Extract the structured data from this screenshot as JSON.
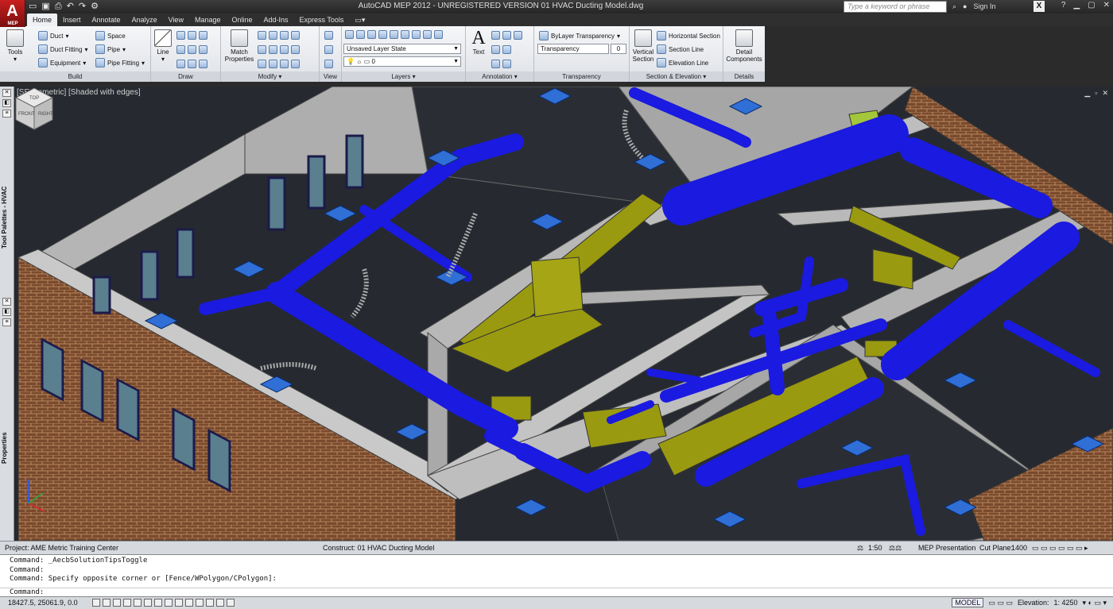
{
  "app": {
    "logo_letter": "A",
    "logo_sub": "MEP",
    "title": "AutoCAD MEP 2012 - UNREGISTERED VERSION    01 HVAC Ducting Model.dwg"
  },
  "quick_access": [
    "open-icon",
    "save-icon",
    "print-icon",
    "undo-icon",
    "redo-icon"
  ],
  "search": {
    "placeholder": "Type a keyword or phrase"
  },
  "signin": {
    "label": "Sign In"
  },
  "help": {
    "label": "?"
  },
  "tabs": [
    {
      "label": "Home"
    },
    {
      "label": "Insert"
    },
    {
      "label": "Annotate"
    },
    {
      "label": "Analyze"
    },
    {
      "label": "View"
    },
    {
      "label": "Manage"
    },
    {
      "label": "Online"
    },
    {
      "label": "Add-Ins"
    },
    {
      "label": "Express Tools"
    }
  ],
  "ribbon": {
    "build": {
      "title": "Build",
      "tools": "Tools",
      "duct": "Duct",
      "duct_fitting": "Duct Fitting",
      "equipment": "Equipment",
      "space": "Space",
      "pipe": "Pipe",
      "pipe_fitting": "Pipe Fitting"
    },
    "draw": {
      "title": "Draw",
      "line": "Line"
    },
    "modify": {
      "title": "Modify",
      "match_properties_1": "Match",
      "match_properties_2": "Properties"
    },
    "view": {
      "title": "View"
    },
    "layers": {
      "title": "Layers",
      "layer_state": "Unsaved Layer State",
      "current_layer": "0"
    },
    "annotation": {
      "title": "Annotation",
      "text": "Text"
    },
    "transparency": {
      "title": "Transparency",
      "bylayer": "ByLayer Transparency",
      "label": "Transparency",
      "value": "0"
    },
    "section_elevation": {
      "title": "Section & Elevation",
      "vertical_section_1": "Vertical",
      "vertical_section_2": "Section",
      "horizontal_section": "Horizontal Section",
      "section_line": "Section Line",
      "elevation_line": "Elevation Line"
    },
    "details": {
      "title": "Details",
      "detail_components_1": "Detail",
      "detail_components_2": "Components"
    }
  },
  "viewport": {
    "label": "[SE Isometric] [Shaded with edges]",
    "viewcube": {
      "top": "TOP",
      "front": "FRONT",
      "right": "RIGHT"
    }
  },
  "palettes": {
    "tool_palettes": "Tool Palettes - HVAC",
    "properties": "Properties"
  },
  "drawing_status": {
    "project": "Project: AME Metric Training Center",
    "construct": "Construct: 01 HVAC Ducting Model",
    "scale": "1:50",
    "display_config": "MEP Presentation",
    "cut_plane_label": "Cut Plane:",
    "cut_plane_value": "1400"
  },
  "command_history": [
    "Command: _AecbSolutionTipsToggle",
    "Command:",
    "Command: Specify opposite corner or [Fence/WPolygon/CPolygon]:"
  ],
  "command_prompt": "Command:",
  "app_status": {
    "coordinates": "18427.5, 25061.9, 0.0",
    "model": "MODEL",
    "elevation_label": "Elevation:",
    "elevation_value": "1: 4250"
  },
  "colors": {
    "duct_blue": "#1a1ae0",
    "equipment_yellow": "#9a9a10",
    "wall_grey": "#b9b9b9",
    "brick": "#8a5a3a",
    "floor": "#262a30"
  }
}
